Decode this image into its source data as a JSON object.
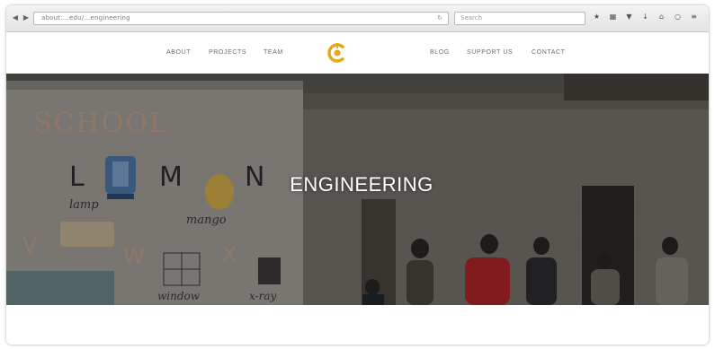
{
  "browser": {
    "url": "about:...edu/...engineering",
    "search_placeholder": "Search",
    "toolbar_icons": [
      "star-icon",
      "bookmarks-icon",
      "pocket-icon",
      "download-icon",
      "home-icon",
      "chat-icon",
      "menu-icon"
    ]
  },
  "nav": {
    "left_items": [
      "ABOUT",
      "PROJECTS",
      "TEAM"
    ],
    "right_items": [
      "BLOG",
      "SUPPORT US",
      "CONTACT"
    ]
  },
  "hero": {
    "title": "ENGINEERING",
    "mural_text": {
      "school": "SCHOOL",
      "l": "L",
      "m": "M",
      "n": "N",
      "lamp": "lamp",
      "mango": "mango",
      "v": "V",
      "w": "W",
      "x": "X",
      "window": "window",
      "xray": "x-ray"
    }
  },
  "colors": {
    "accent": "#e3a81c",
    "nav_text": "#6c6c6c",
    "hero_text": "#ffffff"
  }
}
